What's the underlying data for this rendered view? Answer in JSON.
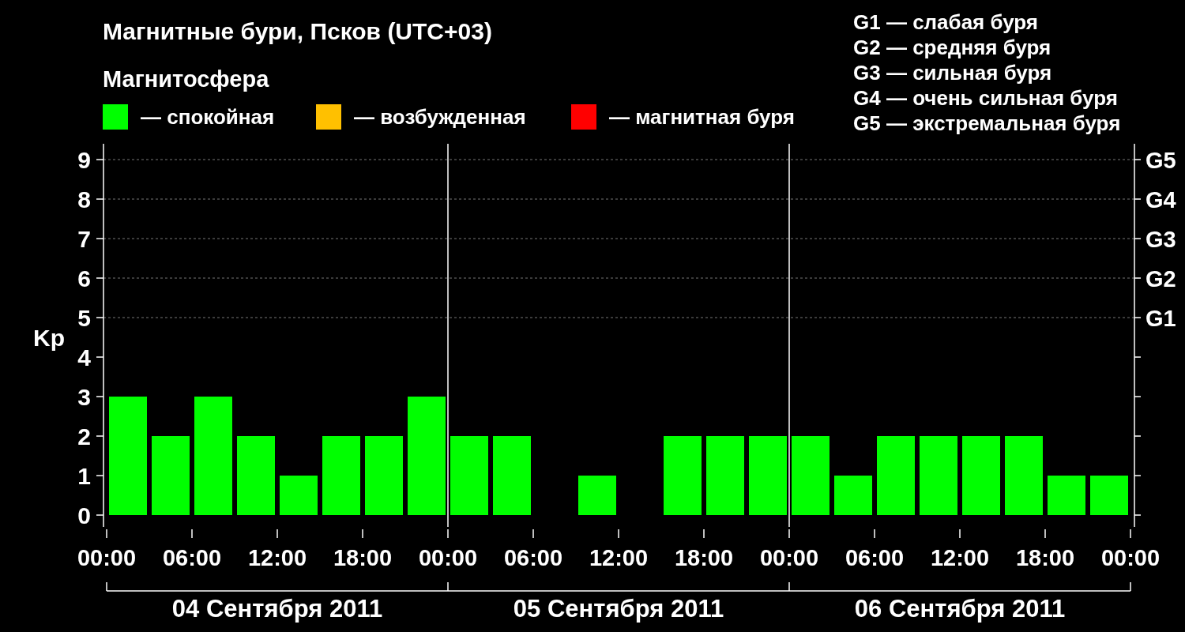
{
  "title": "Магнитные бури, Псков (UTC+03)",
  "subtitle": "Магнитосфера",
  "legend": [
    {
      "label": "— спокойная",
      "color": "#00ff00"
    },
    {
      "label": "— возбужденная",
      "color": "#ffc000"
    },
    {
      "label": "— магнитная буря",
      "color": "#ff0000"
    }
  ],
  "g_legend": [
    "G1 — слабая буря",
    "G2 — средняя буря",
    "G3 — сильная буря",
    "G4 — очень сильная буря",
    "G5 — экстремальная буря"
  ],
  "chart": {
    "chart_data": {
      "type": "bar",
      "ylabel": "Kp",
      "x": [
        "2011-09-04T01:30",
        "2011-09-04T04:30",
        "2011-09-04T07:30",
        "2011-09-04T10:30",
        "2011-09-04T13:30",
        "2011-09-04T16:30",
        "2011-09-04T19:30",
        "2011-09-04T22:30",
        "2011-09-05T01:30",
        "2011-09-05T04:30",
        "2011-09-05T07:30",
        "2011-09-05T10:30",
        "2011-09-05T13:30",
        "2011-09-05T16:30",
        "2011-09-05T19:30",
        "2011-09-05T22:30",
        "2011-09-06T01:30",
        "2011-09-06T04:30",
        "2011-09-06T07:30",
        "2011-09-06T10:30",
        "2011-09-06T13:30",
        "2011-09-06T16:30",
        "2011-09-06T19:30",
        "2011-09-06T22:30"
      ],
      "series": [
        {
          "color": "#00ff00",
          "values": [
            3,
            2,
            3,
            2,
            1,
            2,
            2,
            3,
            2,
            2,
            null,
            1,
            null,
            2,
            2,
            2,
            2,
            1,
            2,
            2,
            2,
            2,
            1,
            1
          ]
        }
      ],
      "xlim": [
        "2011-09-04T00:00",
        "2011-09-07T00:00"
      ],
      "ylim": [
        -0.3,
        9.4
      ],
      "xticks": [
        {
          "value": "2011-09-04T00:00",
          "label": "00:00"
        },
        {
          "value": "2011-09-04T06:00",
          "label": "06:00"
        },
        {
          "value": "2011-09-04T12:00",
          "label": "12:00"
        },
        {
          "value": "2011-09-04T18:00",
          "label": "18:00"
        },
        {
          "value": "2011-09-05T00:00",
          "label": "00:00"
        },
        {
          "value": "2011-09-05T06:00",
          "label": "06:00"
        },
        {
          "value": "2011-09-05T12:00",
          "label": "12:00"
        },
        {
          "value": "2011-09-05T18:00",
          "label": "18:00"
        },
        {
          "value": "2011-09-06T00:00",
          "label": "00:00"
        },
        {
          "value": "2011-09-06T06:00",
          "label": "06:00"
        },
        {
          "value": "2011-09-06T12:00",
          "label": "12:00"
        },
        {
          "value": "2011-09-06T18:00",
          "label": "18:00"
        },
        {
          "value": "2011-09-07T00:00",
          "label": "00:00"
        }
      ],
      "yticks": [
        0,
        1,
        2,
        3,
        4,
        5,
        6,
        7,
        8,
        9
      ],
      "grid": true
    },
    "g_scale": [
      "G5",
      "G4",
      "G3",
      "G2",
      "G1"
    ],
    "days": [
      "04 Сентября 2011",
      "05 Сентября 2011",
      "06 Сентября 2011"
    ]
  }
}
